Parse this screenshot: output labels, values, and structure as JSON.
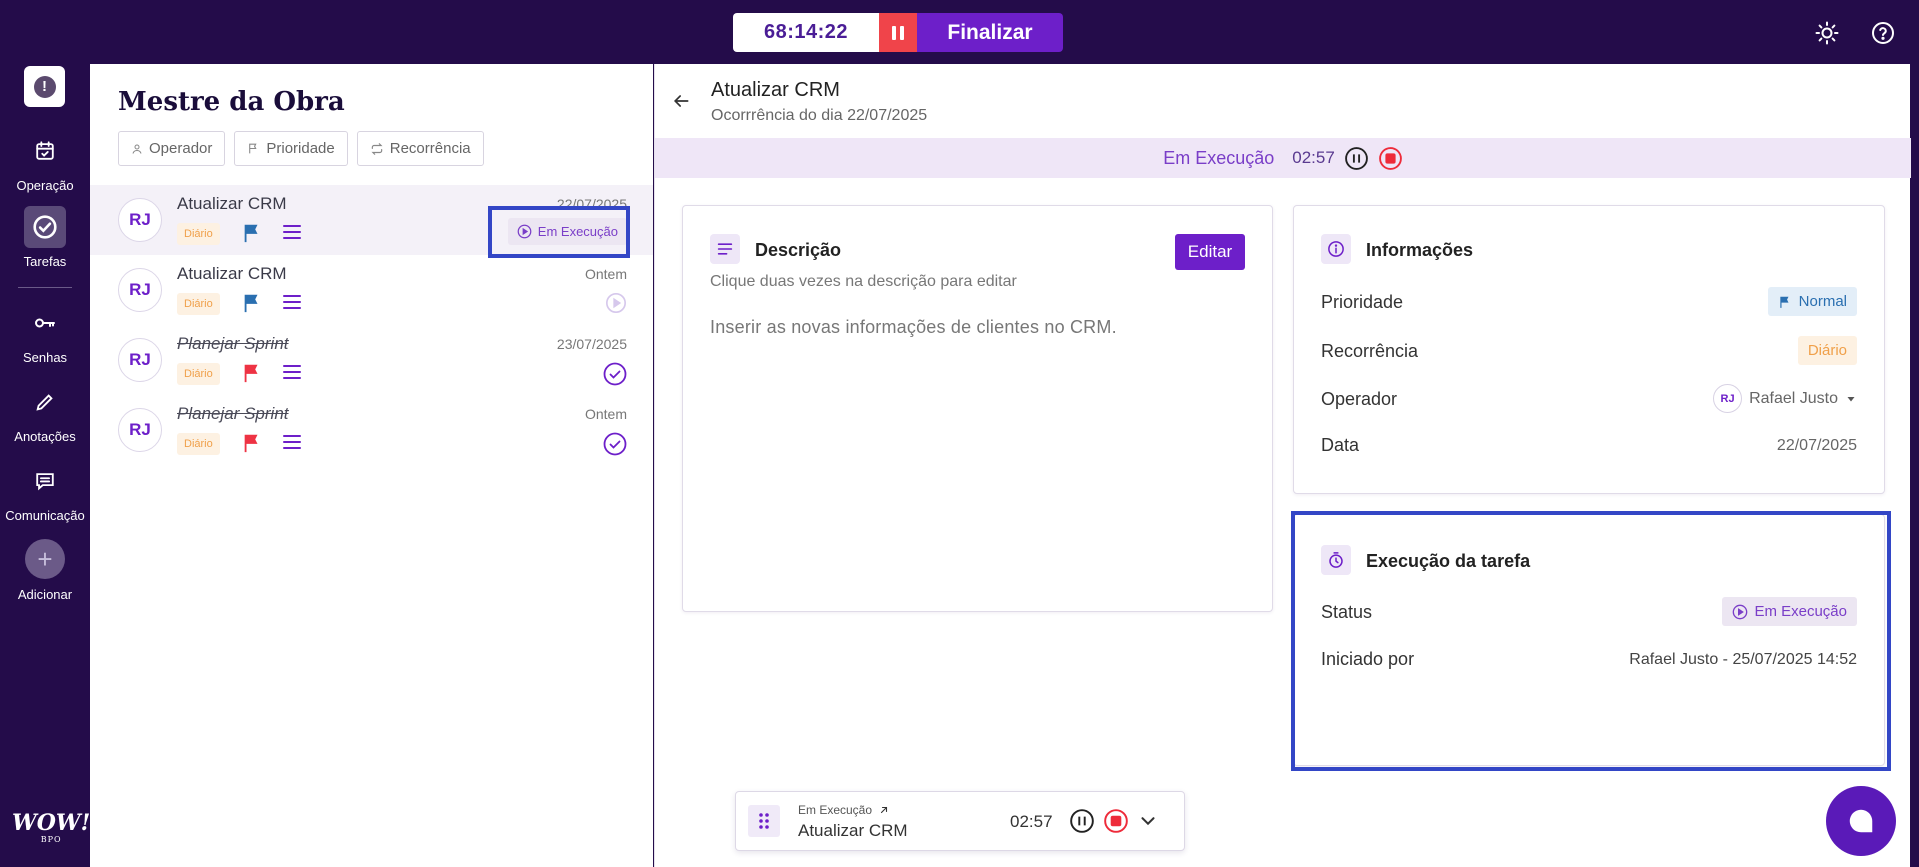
{
  "topbar": {
    "timer": "68:14:22",
    "finalize_label": "Finalizar",
    "icons": [
      "pause-icon",
      "sun-icon",
      "help-icon"
    ]
  },
  "nav": {
    "items": [
      {
        "label": "Operação",
        "icon": "calendar-check-icon"
      },
      {
        "label": "Tarefas",
        "icon": "check-circle-icon"
      },
      {
        "label": "Senhas",
        "icon": "key-icon"
      },
      {
        "label": "Anotações",
        "icon": "pencil-icon"
      },
      {
        "label": "Comunicação",
        "icon": "message-icon"
      },
      {
        "label": "Adicionar",
        "icon": "plus-icon"
      }
    ],
    "logo_text": "WOW!",
    "logo_sub": "BPO"
  },
  "list": {
    "title": "Mestre da Obra",
    "filters": [
      "Operador",
      "Prioridade",
      "Recorrência"
    ],
    "tasks": [
      {
        "initials": "RJ",
        "name": "Atualizar CRM",
        "tag": "Diário",
        "date": "22/07/2025",
        "status": "Em Execução",
        "done": false,
        "flag_color": "#2a6fb0"
      },
      {
        "initials": "RJ",
        "name": "Atualizar CRM",
        "tag": "Diário",
        "date": "Ontem",
        "status": "pending",
        "done": false,
        "flag_color": "#2a6fb0"
      },
      {
        "initials": "RJ",
        "name": "Planejar Sprint",
        "tag": "Diário",
        "date": "23/07/2025",
        "status": "done",
        "done": true,
        "flag_color": "#ee3344"
      },
      {
        "initials": "RJ",
        "name": "Planejar Sprint",
        "tag": "Diário",
        "date": "Ontem",
        "status": "done",
        "done": true,
        "flag_color": "#ee3344"
      }
    ]
  },
  "detail": {
    "title": "Atualizar CRM",
    "subtitle": "Ocorrrência do dia 22/07/2025",
    "exec_bar": {
      "status": "Em Execução",
      "time": "02:57"
    },
    "description": {
      "title": "Descrição",
      "hint": "Clique duas vezes na descrição para editar",
      "text": "Inserir as novas informações de clientes no CRM.",
      "edit_label": "Editar"
    },
    "info": {
      "title": "Informações",
      "priority_label": "Prioridade",
      "priority_value": "Normal",
      "recurrence_label": "Recorrência",
      "recurrence_value": "Diário",
      "operator_label": "Operador",
      "operator_initials": "RJ",
      "operator_value": "Rafael Justo",
      "date_label": "Data",
      "date_value": "22/07/2025"
    },
    "execution": {
      "title": "Execução da tarefa",
      "status_label": "Status",
      "status_value": "Em Execução",
      "started_label": "Iniciado por",
      "started_value": "Rafael Justo - 25/07/2025 14:52"
    }
  },
  "mini_player": {
    "status": "Em Execução",
    "task": "Atualizar CRM",
    "time": "02:57"
  },
  "colors": {
    "brand_dark": "#240c4a",
    "accent": "#6d1fc9",
    "stop_red": "#f0444a",
    "highlight": "#3346c6"
  }
}
